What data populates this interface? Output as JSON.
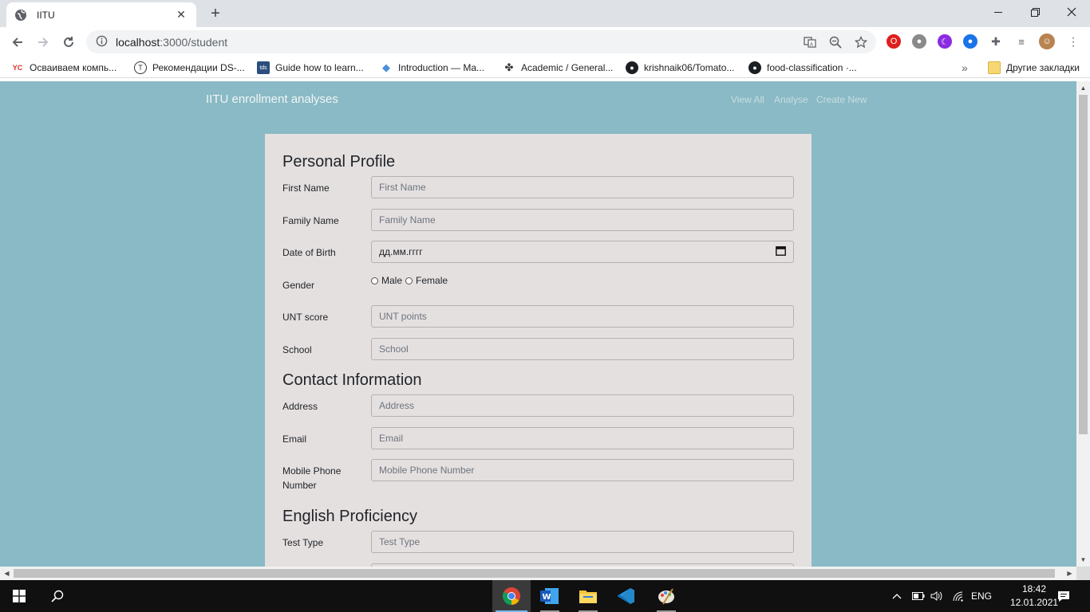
{
  "browser": {
    "tab": {
      "title": "IITU"
    },
    "address": {
      "host": "localhost",
      "path": ":3000/student"
    },
    "bookmarks": [
      {
        "label": "Осваиваем компь...",
        "icon": "yc-icon"
      },
      {
        "label": "Рекомендации DS-...",
        "icon": "ds-icon"
      },
      {
        "label": "Guide how to learn...",
        "icon": "tds-icon"
      },
      {
        "label": "Introduction — Ma...",
        "icon": "ml-icon"
      },
      {
        "label": "Academic / General...",
        "icon": "clover-icon"
      },
      {
        "label": "krishnaik06/Tomato...",
        "icon": "github-icon"
      },
      {
        "label": "food-classification ·...",
        "icon": "github-icon"
      }
    ],
    "bookmarks_more": "»",
    "other_bookmarks": "Другие закладки"
  },
  "navbar": {
    "brand": "IITU enrollment analyses",
    "links": [
      "View All",
      "Analyse",
      "Create New"
    ]
  },
  "form": {
    "personal": {
      "title": "Personal Profile",
      "first_name": {
        "label": "First Name",
        "placeholder": "First Name"
      },
      "family_name": {
        "label": "Family Name",
        "placeholder": "Family Name"
      },
      "dob": {
        "label": "Date of Birth",
        "placeholder": "дд.мм.гггг"
      },
      "gender": {
        "label": "Gender",
        "options": [
          "Male",
          "Female"
        ]
      },
      "unt": {
        "label": "UNT score",
        "placeholder": "UNT points"
      },
      "school": {
        "label": "School",
        "placeholder": "School"
      }
    },
    "contact": {
      "title": "Contact Information",
      "address": {
        "label": "Address",
        "placeholder": "Address"
      },
      "email": {
        "label": "Email",
        "placeholder": "Email"
      },
      "phone": {
        "label_line1": "Mobile Phone",
        "label_line2": "Number",
        "placeholder": "Mobile Phone Number"
      }
    },
    "english": {
      "title": "English Proficiency",
      "test_type": {
        "label": "Test Type",
        "placeholder": "Test Type"
      }
    }
  },
  "taskbar": {
    "language": "ENG",
    "time": "18:42",
    "date": "12.01.2021"
  },
  "colors": {
    "page_bg": "#89bac5",
    "card_bg": "#e5e0e0",
    "tabstrip": "#dee1e6",
    "taskbar": "#101010"
  }
}
